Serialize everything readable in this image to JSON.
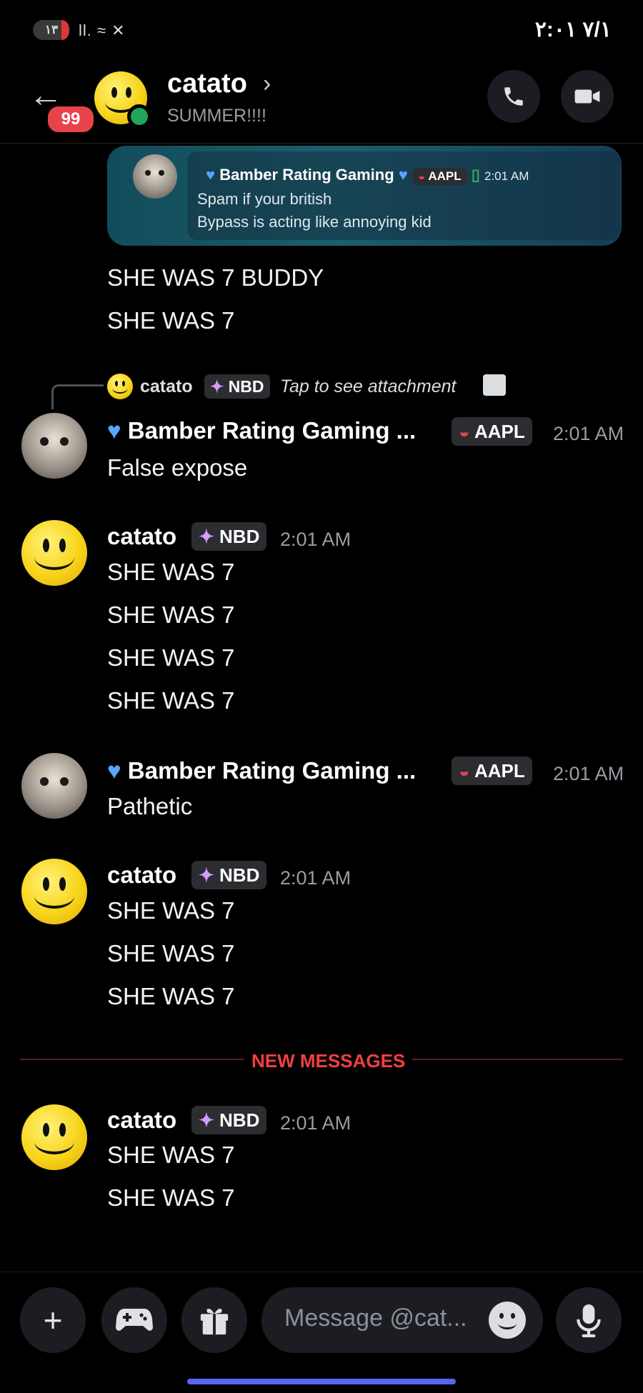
{
  "status_bar": {
    "battery": "۱۳",
    "signal": "ll. ≈ ✕",
    "time": "۲:۰۱ ۷/۱"
  },
  "header": {
    "back_icon": "arrow-left-icon",
    "unread_badge": "99",
    "title": "catato",
    "chevron": "›",
    "subtitle": "SUMMER!!!!",
    "call_icon": "phone-icon",
    "video_icon": "video-icon"
  },
  "pinned_card": {
    "author": "Bamber Rating Gaming",
    "tag": "AAPL",
    "time": "2:01 AM",
    "line1": "Spam if your british",
    "line2": "Bypass is acting like annoying kid"
  },
  "messages_top": [
    "SHE WAS 7 BUDDY",
    "SHE WAS 7"
  ],
  "reply_ref": {
    "user": "catato",
    "tag": "NBD",
    "text": "Tap to see attachment"
  },
  "groups": [
    {
      "user": "Bamber Rating Gaming ...",
      "tag": "AAPL",
      "time": "2:01 AM",
      "lines": [
        "False expose"
      ]
    },
    {
      "user": "catato",
      "tag": "NBD",
      "time": "2:01 AM",
      "lines": [
        "SHE WAS 7",
        "SHE WAS 7",
        "SHE WAS 7",
        "SHE WAS 7"
      ]
    },
    {
      "user": "Bamber Rating Gaming ...",
      "tag": "AAPL",
      "time": "2:01 AM",
      "lines": [
        "Pathetic"
      ]
    },
    {
      "user": "catato",
      "tag": "NBD",
      "time": "2:01 AM",
      "lines": [
        "SHE WAS 7",
        "SHE WAS 7",
        "SHE WAS 7"
      ]
    },
    {
      "user": "catato",
      "tag": "NBD",
      "time": "2:01 AM",
      "lines": [
        "SHE WAS 7",
        "SHE WAS 7"
      ]
    }
  ],
  "divider": {
    "label": "NEW MESSAGES"
  },
  "composer": {
    "placeholder": "Message @cat...",
    "plus_icon": "plus-icon",
    "game_icon": "gamepad-icon",
    "gift_icon": "gift-icon",
    "emoji_icon": "emoji-icon",
    "mic_icon": "microphone-icon"
  },
  "colors": {
    "accent": "#5865f2",
    "new_messages": "#f23f43",
    "online": "#23a55a"
  }
}
